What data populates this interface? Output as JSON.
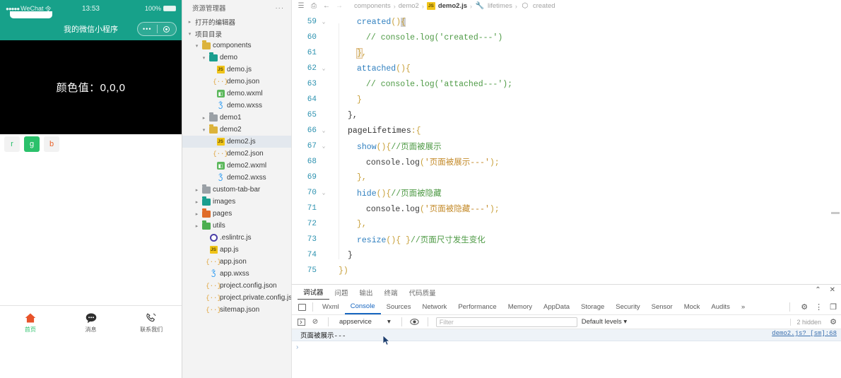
{
  "simulator": {
    "status": {
      "carrier": "WeChat",
      "dots": "●●●●●",
      "signal": "令",
      "time": "13:53",
      "battery": "100%"
    },
    "navbar": {
      "title": "我的微信小程序",
      "capsule_dots": "•••"
    },
    "canvas": {
      "color_text": "颜色值：0,0,0"
    },
    "rgb_buttons": [
      {
        "label": "r",
        "active": false
      },
      {
        "label": "g",
        "active": true
      },
      {
        "label": "b",
        "active": false
      }
    ],
    "tabbar": [
      {
        "label": "首页",
        "icon": "home-icon",
        "active": true
      },
      {
        "label": "消息",
        "icon": "chat-icon",
        "active": false
      },
      {
        "label": "联系我们",
        "icon": "phone-icon",
        "active": false
      }
    ]
  },
  "explorer": {
    "title": "资源管理器",
    "more": "···",
    "sections": [
      {
        "label": "打开的编辑器",
        "expanded": false
      },
      {
        "label": "项目目录",
        "expanded": true
      }
    ],
    "tree": [
      {
        "label": "components",
        "icon": "folder-components",
        "indent": 1,
        "twisty": "▾",
        "kind": "folder-yellow"
      },
      {
        "label": "demo",
        "icon": "folder-demo",
        "indent": 2,
        "twisty": "▾",
        "kind": "folder-teal"
      },
      {
        "label": "demo.js",
        "icon": "js-file-icon",
        "indent": 3,
        "twisty": "",
        "kind": "js"
      },
      {
        "label": "demo.json",
        "icon": "json-file-icon",
        "indent": 3,
        "twisty": "",
        "kind": "json"
      },
      {
        "label": "demo.wxml",
        "icon": "wxml-file-icon",
        "indent": 3,
        "twisty": "",
        "kind": "wxml"
      },
      {
        "label": "demo.wxss",
        "icon": "wxss-file-icon",
        "indent": 3,
        "twisty": "",
        "kind": "wxss"
      },
      {
        "label": "demo1",
        "icon": "folder-demo1",
        "indent": 2,
        "twisty": "▸",
        "kind": "folder-grey"
      },
      {
        "label": "demo2",
        "icon": "folder-demo2",
        "indent": 2,
        "twisty": "▾",
        "kind": "folder-yellow"
      },
      {
        "label": "demo2.js",
        "icon": "js-file-icon",
        "indent": 3,
        "twisty": "",
        "kind": "js",
        "selected": true
      },
      {
        "label": "demo2.json",
        "icon": "json-file-icon",
        "indent": 3,
        "twisty": "",
        "kind": "json"
      },
      {
        "label": "demo2.wxml",
        "icon": "wxml-file-icon",
        "indent": 3,
        "twisty": "",
        "kind": "wxml"
      },
      {
        "label": "demo2.wxss",
        "icon": "wxss-file-icon",
        "indent": 3,
        "twisty": "",
        "kind": "wxss"
      },
      {
        "label": "custom-tab-bar",
        "icon": "folder-custom-tab-bar",
        "indent": 1,
        "twisty": "▸",
        "kind": "folder-grey"
      },
      {
        "label": "images",
        "icon": "folder-images",
        "indent": 1,
        "twisty": "▸",
        "kind": "folder-teal"
      },
      {
        "label": "pages",
        "icon": "folder-pages",
        "indent": 1,
        "twisty": "▸",
        "kind": "folder-orange"
      },
      {
        "label": "utils",
        "icon": "folder-utils",
        "indent": 1,
        "twisty": "▸",
        "kind": "folder-green"
      },
      {
        "label": ".eslintrc.js",
        "icon": "eslint-file-icon",
        "indent": 2,
        "twisty": "",
        "kind": "eslint"
      },
      {
        "label": "app.js",
        "icon": "js-file-icon",
        "indent": 2,
        "twisty": "",
        "kind": "js"
      },
      {
        "label": "app.json",
        "icon": "json-file-icon",
        "indent": 2,
        "twisty": "",
        "kind": "json"
      },
      {
        "label": "app.wxss",
        "icon": "wxss-file-icon",
        "indent": 2,
        "twisty": "",
        "kind": "wxss"
      },
      {
        "label": "project.config.json",
        "icon": "json-file-icon",
        "indent": 2,
        "twisty": "",
        "kind": "json"
      },
      {
        "label": "project.private.config.js...",
        "icon": "json-file-icon",
        "indent": 2,
        "twisty": "",
        "kind": "json"
      },
      {
        "label": "sitemap.json",
        "icon": "json-file-icon",
        "indent": 2,
        "twisty": "",
        "kind": "json"
      }
    ]
  },
  "breadcrumb": {
    "icons": [
      "list-icon",
      "bookmark-icon",
      "arrow-left-icon",
      "arrow-right-icon"
    ],
    "glyphs": [
      "☰",
      "⎙",
      "←",
      "→"
    ],
    "items": [
      {
        "label": "components",
        "strong": false
      },
      {
        "label": "demo2",
        "strong": false
      },
      {
        "label": "demo2.js",
        "strong": true,
        "icon": "js-file-icon"
      },
      {
        "label": "lifetimes",
        "strong": false,
        "icon": "wrench-icon"
      },
      {
        "label": "created",
        "strong": false,
        "icon": "symbol-icon"
      }
    ],
    "separator": "›"
  },
  "code": {
    "lines": [
      {
        "num": "59",
        "fold": "⌄",
        "indent": 2,
        "segs": [
          {
            "t": "created",
            "c": "k-fn"
          },
          {
            "t": "()",
            "c": "k-pun"
          },
          {
            "t": "{",
            "c": "k-pun cursor-blk"
          }
        ]
      },
      {
        "num": "60",
        "fold": "",
        "indent": 3,
        "segs": [
          {
            "t": "// console.log('created---')",
            "c": "k-com"
          }
        ]
      },
      {
        "num": "61",
        "fold": "",
        "indent": 2,
        "segs": [
          {
            "t": "}",
            "c": "k-pun hl-box"
          },
          {
            "t": ",",
            "c": "k-pun"
          }
        ]
      },
      {
        "num": "62",
        "fold": "⌄",
        "indent": 2,
        "segs": [
          {
            "t": "attached",
            "c": "k-fn"
          },
          {
            "t": "(){",
            "c": "k-pun"
          }
        ]
      },
      {
        "num": "63",
        "fold": "",
        "indent": 3,
        "segs": [
          {
            "t": "// console.log('attached---');",
            "c": "k-com"
          }
        ]
      },
      {
        "num": "64",
        "fold": "",
        "indent": 2,
        "segs": [
          {
            "t": "}",
            "c": "k-pun"
          }
        ]
      },
      {
        "num": "65",
        "fold": "",
        "indent": 1,
        "segs": [
          {
            "t": "},",
            "c": "k-plain"
          }
        ]
      },
      {
        "num": "66",
        "fold": "⌄",
        "indent": 1,
        "segs": [
          {
            "t": "pageLifetimes",
            "c": "k-id"
          },
          {
            "t": ":{",
            "c": "k-pun"
          }
        ]
      },
      {
        "num": "67",
        "fold": "⌄",
        "indent": 2,
        "segs": [
          {
            "t": "show",
            "c": "k-fn"
          },
          {
            "t": "(){",
            "c": "k-pun"
          },
          {
            "t": "//页面被展示",
            "c": "k-cn"
          }
        ]
      },
      {
        "num": "68",
        "fold": "",
        "indent": 3,
        "segs": [
          {
            "t": "console",
            "c": "k-plain"
          },
          {
            "t": ".",
            "c": "k-plain"
          },
          {
            "t": "log",
            "c": "k-plain"
          },
          {
            "t": "(",
            "c": "k-pun"
          },
          {
            "t": "'页面被展示---'",
            "c": "k-str"
          },
          {
            "t": ");",
            "c": "k-pun"
          }
        ]
      },
      {
        "num": "69",
        "fold": "",
        "indent": 2,
        "segs": [
          {
            "t": "},",
            "c": "k-pun"
          }
        ]
      },
      {
        "num": "70",
        "fold": "⌄",
        "indent": 2,
        "segs": [
          {
            "t": "hide",
            "c": "k-fn"
          },
          {
            "t": "(){",
            "c": "k-pun"
          },
          {
            "t": "//页面被隐藏",
            "c": "k-cn"
          }
        ]
      },
      {
        "num": "71",
        "fold": "",
        "indent": 3,
        "segs": [
          {
            "t": "console",
            "c": "k-plain"
          },
          {
            "t": ".",
            "c": "k-plain"
          },
          {
            "t": "log",
            "c": "k-plain"
          },
          {
            "t": "(",
            "c": "k-pun"
          },
          {
            "t": "'页面被隐藏---'",
            "c": "k-str"
          },
          {
            "t": ");",
            "c": "k-pun"
          }
        ]
      },
      {
        "num": "72",
        "fold": "",
        "indent": 2,
        "segs": [
          {
            "t": "},",
            "c": "k-pun"
          }
        ]
      },
      {
        "num": "73",
        "fold": "",
        "indent": 2,
        "segs": [
          {
            "t": "resize",
            "c": "k-fn"
          },
          {
            "t": "(){ }",
            "c": "k-pun"
          },
          {
            "t": "//页面尺寸发生变化",
            "c": "k-cn"
          }
        ]
      },
      {
        "num": "74",
        "fold": "",
        "indent": 1,
        "segs": [
          {
            "t": "}",
            "c": "k-plain"
          }
        ]
      },
      {
        "num": "75",
        "fold": "",
        "indent": 0,
        "segs": [
          {
            "t": "})",
            "c": "k-pun"
          }
        ]
      }
    ]
  },
  "devtools": {
    "panel_tabs": [
      {
        "label": "调试器",
        "active": true
      },
      {
        "label": "问题",
        "active": false
      },
      {
        "label": "输出",
        "active": false
      },
      {
        "label": "终端",
        "active": false
      },
      {
        "label": "代码质量",
        "active": false
      }
    ],
    "window_controls": [
      {
        "name": "chevron-up-icon",
        "glyph": "⌃"
      },
      {
        "name": "close-icon",
        "glyph": "✕"
      }
    ],
    "tabs": [
      {
        "label": "Wxml",
        "active": false
      },
      {
        "label": "Console",
        "active": true
      },
      {
        "label": "Sources",
        "active": false
      },
      {
        "label": "Network",
        "active": false
      },
      {
        "label": "Performance",
        "active": false
      },
      {
        "label": "Memory",
        "active": false
      },
      {
        "label": "AppData",
        "active": false
      },
      {
        "label": "Storage",
        "active": false
      },
      {
        "label": "Security",
        "active": false
      },
      {
        "label": "Sensor",
        "active": false
      },
      {
        "label": "Mock",
        "active": false
      },
      {
        "label": "Audits",
        "active": false
      },
      {
        "label": "»",
        "active": false
      }
    ],
    "tab_right_icons": [
      {
        "name": "settings-gear-icon",
        "glyph": "⚙"
      },
      {
        "name": "kebab-menu-icon",
        "glyph": "⋮"
      },
      {
        "name": "dock-panel-icon",
        "glyph": "❐"
      }
    ],
    "toolbar": {
      "sidebar_icon": "console-sidebar-icon",
      "clear_icon": "clear-console-icon",
      "clear_glyph": "⊘",
      "context": "appservice",
      "context_caret": "▾",
      "eye_icon": "live-expression-icon",
      "eye_glyph": "👁",
      "filter_placeholder": "Filter",
      "levels": "Default levels",
      "levels_caret": "▾",
      "hidden": "2 hidden",
      "gear_glyph": "⚙"
    },
    "console": {
      "messages": [
        {
          "text": "页面被展示---",
          "source": "demo2.js? [sm]:68"
        }
      ],
      "prompt": "›"
    }
  }
}
